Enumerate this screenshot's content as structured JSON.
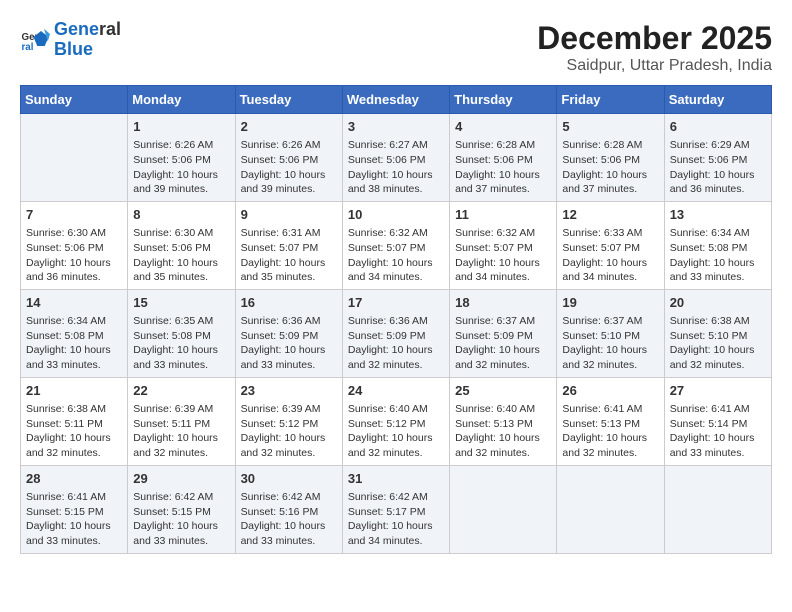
{
  "logo": {
    "line1": "General",
    "line2": "Blue"
  },
  "title": "December 2025",
  "subtitle": "Saidpur, Uttar Pradesh, India",
  "headers": [
    "Sunday",
    "Monday",
    "Tuesday",
    "Wednesday",
    "Thursday",
    "Friday",
    "Saturday"
  ],
  "weeks": [
    [
      {
        "day": "",
        "info": ""
      },
      {
        "day": "1",
        "info": "Sunrise: 6:26 AM\nSunset: 5:06 PM\nDaylight: 10 hours\nand 39 minutes."
      },
      {
        "day": "2",
        "info": "Sunrise: 6:26 AM\nSunset: 5:06 PM\nDaylight: 10 hours\nand 39 minutes."
      },
      {
        "day": "3",
        "info": "Sunrise: 6:27 AM\nSunset: 5:06 PM\nDaylight: 10 hours\nand 38 minutes."
      },
      {
        "day": "4",
        "info": "Sunrise: 6:28 AM\nSunset: 5:06 PM\nDaylight: 10 hours\nand 37 minutes."
      },
      {
        "day": "5",
        "info": "Sunrise: 6:28 AM\nSunset: 5:06 PM\nDaylight: 10 hours\nand 37 minutes."
      },
      {
        "day": "6",
        "info": "Sunrise: 6:29 AM\nSunset: 5:06 PM\nDaylight: 10 hours\nand 36 minutes."
      }
    ],
    [
      {
        "day": "7",
        "info": "Sunrise: 6:30 AM\nSunset: 5:06 PM\nDaylight: 10 hours\nand 36 minutes."
      },
      {
        "day": "8",
        "info": "Sunrise: 6:30 AM\nSunset: 5:06 PM\nDaylight: 10 hours\nand 35 minutes."
      },
      {
        "day": "9",
        "info": "Sunrise: 6:31 AM\nSunset: 5:07 PM\nDaylight: 10 hours\nand 35 minutes."
      },
      {
        "day": "10",
        "info": "Sunrise: 6:32 AM\nSunset: 5:07 PM\nDaylight: 10 hours\nand 34 minutes."
      },
      {
        "day": "11",
        "info": "Sunrise: 6:32 AM\nSunset: 5:07 PM\nDaylight: 10 hours\nand 34 minutes."
      },
      {
        "day": "12",
        "info": "Sunrise: 6:33 AM\nSunset: 5:07 PM\nDaylight: 10 hours\nand 34 minutes."
      },
      {
        "day": "13",
        "info": "Sunrise: 6:34 AM\nSunset: 5:08 PM\nDaylight: 10 hours\nand 33 minutes."
      }
    ],
    [
      {
        "day": "14",
        "info": "Sunrise: 6:34 AM\nSunset: 5:08 PM\nDaylight: 10 hours\nand 33 minutes."
      },
      {
        "day": "15",
        "info": "Sunrise: 6:35 AM\nSunset: 5:08 PM\nDaylight: 10 hours\nand 33 minutes."
      },
      {
        "day": "16",
        "info": "Sunrise: 6:36 AM\nSunset: 5:09 PM\nDaylight: 10 hours\nand 33 minutes."
      },
      {
        "day": "17",
        "info": "Sunrise: 6:36 AM\nSunset: 5:09 PM\nDaylight: 10 hours\nand 32 minutes."
      },
      {
        "day": "18",
        "info": "Sunrise: 6:37 AM\nSunset: 5:09 PM\nDaylight: 10 hours\nand 32 minutes."
      },
      {
        "day": "19",
        "info": "Sunrise: 6:37 AM\nSunset: 5:10 PM\nDaylight: 10 hours\nand 32 minutes."
      },
      {
        "day": "20",
        "info": "Sunrise: 6:38 AM\nSunset: 5:10 PM\nDaylight: 10 hours\nand 32 minutes."
      }
    ],
    [
      {
        "day": "21",
        "info": "Sunrise: 6:38 AM\nSunset: 5:11 PM\nDaylight: 10 hours\nand 32 minutes."
      },
      {
        "day": "22",
        "info": "Sunrise: 6:39 AM\nSunset: 5:11 PM\nDaylight: 10 hours\nand 32 minutes."
      },
      {
        "day": "23",
        "info": "Sunrise: 6:39 AM\nSunset: 5:12 PM\nDaylight: 10 hours\nand 32 minutes."
      },
      {
        "day": "24",
        "info": "Sunrise: 6:40 AM\nSunset: 5:12 PM\nDaylight: 10 hours\nand 32 minutes."
      },
      {
        "day": "25",
        "info": "Sunrise: 6:40 AM\nSunset: 5:13 PM\nDaylight: 10 hours\nand 32 minutes."
      },
      {
        "day": "26",
        "info": "Sunrise: 6:41 AM\nSunset: 5:13 PM\nDaylight: 10 hours\nand 32 minutes."
      },
      {
        "day": "27",
        "info": "Sunrise: 6:41 AM\nSunset: 5:14 PM\nDaylight: 10 hours\nand 33 minutes."
      }
    ],
    [
      {
        "day": "28",
        "info": "Sunrise: 6:41 AM\nSunset: 5:15 PM\nDaylight: 10 hours\nand 33 minutes."
      },
      {
        "day": "29",
        "info": "Sunrise: 6:42 AM\nSunset: 5:15 PM\nDaylight: 10 hours\nand 33 minutes."
      },
      {
        "day": "30",
        "info": "Sunrise: 6:42 AM\nSunset: 5:16 PM\nDaylight: 10 hours\nand 33 minutes."
      },
      {
        "day": "31",
        "info": "Sunrise: 6:42 AM\nSunset: 5:17 PM\nDaylight: 10 hours\nand 34 minutes."
      },
      {
        "day": "",
        "info": ""
      },
      {
        "day": "",
        "info": ""
      },
      {
        "day": "",
        "info": ""
      }
    ]
  ]
}
